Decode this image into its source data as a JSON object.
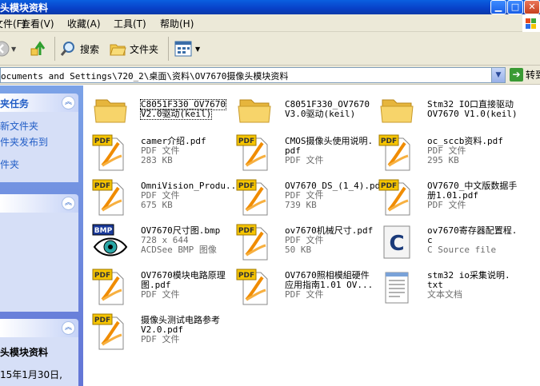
{
  "window": {
    "title": "头模块资料"
  },
  "menu": [
    "文件(F)",
    "查看(V)",
    "收藏(A)",
    "工具(T)",
    "帮助(H)"
  ],
  "toolbar": {
    "search_label": "搜索",
    "folders_label": "文件夹"
  },
  "address": {
    "path": "ocuments and Settings\\720_2\\桌面\\资料\\OV7670摄像头模块资料",
    "go_label": "转到"
  },
  "tasks": {
    "header": "夹任务",
    "links": [
      "新文件夹",
      "件夹发布到",
      "件夹"
    ]
  },
  "details": {
    "name": "头模块资料",
    "modified": "15年1月30日,"
  },
  "files": [
    {
      "name": [
        "C8051F330_OV7670",
        "V2.0驱动(keil)"
      ],
      "type": "folder",
      "meta": []
    },
    {
      "name": [
        "C8051F330_OV7670",
        "V3.0驱动(keil)"
      ],
      "type": "folder",
      "meta": []
    },
    {
      "name": [
        "Stm32 IO口直接驱动",
        "OV7670 V1.0(keil)"
      ],
      "type": "folder",
      "meta": []
    },
    {
      "name": [
        "camer介绍.pdf"
      ],
      "type": "pdf",
      "meta": [
        "PDF 文件",
        "283 KB"
      ]
    },
    {
      "name": [
        "CMOS摄像头使用说明.",
        "pdf"
      ],
      "type": "pdf",
      "meta": [
        "PDF 文件"
      ]
    },
    {
      "name": [
        "oc_sccb资料.pdf"
      ],
      "type": "pdf",
      "meta": [
        "PDF 文件",
        "295 KB"
      ]
    },
    {
      "name": [
        "OmniVision_Produ..."
      ],
      "type": "pdf",
      "meta": [
        "PDF 文件",
        "675 KB"
      ]
    },
    {
      "name": [
        "OV7670_DS_(1_4).pdf"
      ],
      "type": "pdf",
      "meta": [
        "PDF 文件",
        "739 KB"
      ]
    },
    {
      "name": [
        "OV7670_中文版数据手",
        "册1.01.pdf"
      ],
      "type": "pdf",
      "meta": [
        "PDF 文件"
      ]
    },
    {
      "name": [
        "OV7670尺寸图.bmp"
      ],
      "type": "bmp",
      "meta": [
        "728 x 644",
        "ACDSee BMP 图像"
      ]
    },
    {
      "name": [
        "ov7670机械尺寸.pdf"
      ],
      "type": "pdf",
      "meta": [
        "PDF 文件",
        "50 KB"
      ]
    },
    {
      "name": [
        "ov7670寄存器配置程.",
        "c"
      ],
      "type": "c",
      "meta": [
        "C Source file"
      ]
    },
    {
      "name": [
        "OV7670模块电路原理",
        "图.pdf"
      ],
      "type": "pdf",
      "meta": [
        "PDF 文件"
      ]
    },
    {
      "name": [
        "OV7670照相模組硬件",
        "应用指南1.01 OV..."
      ],
      "type": "pdf",
      "meta": [
        "PDF 文件"
      ]
    },
    {
      "name": [
        "stm32 io采集说明.",
        "txt"
      ],
      "type": "txt",
      "meta": [
        "文本文档"
      ]
    },
    {
      "name": [
        "摄像头测试电路参考",
        "V2.0.pdf"
      ],
      "type": "pdf",
      "meta": [
        "PDF 文件"
      ]
    }
  ],
  "icon_labels": {
    "pdf": "PDF",
    "bmp": "BMP",
    "c": "C"
  },
  "colors": {
    "title_bar": "#0a5fe0",
    "task_pane": "#7ba2e7",
    "link": "#215dc6",
    "pdf_orange": "#f08c00"
  }
}
